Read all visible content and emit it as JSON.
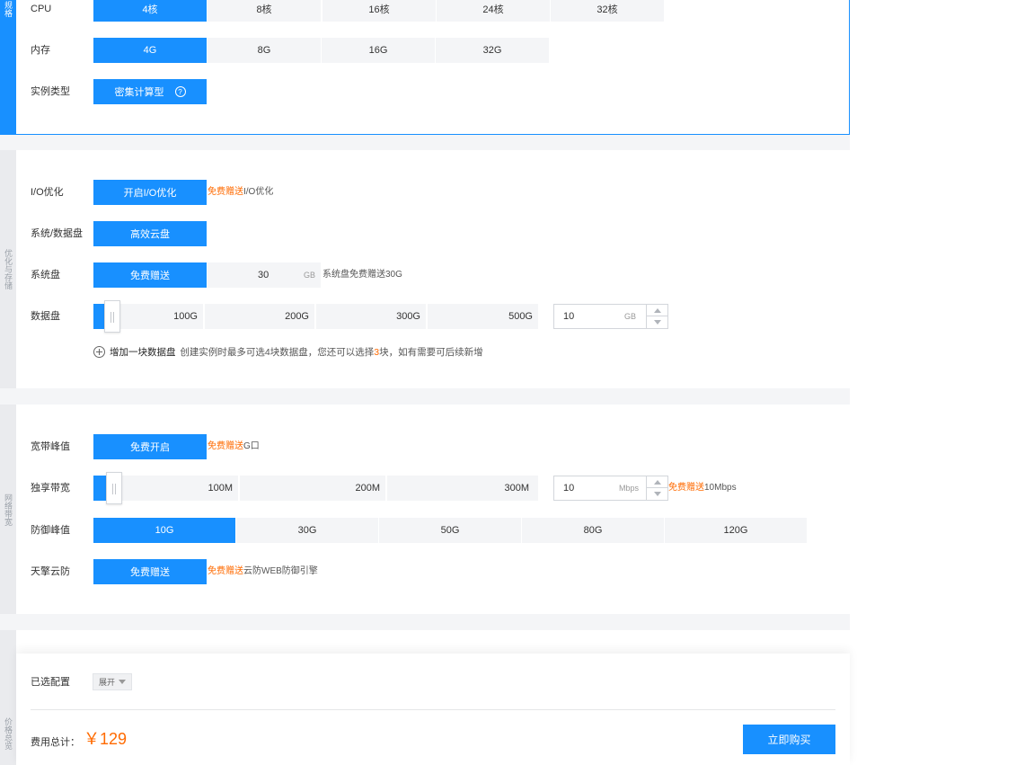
{
  "tabs": {
    "spec": "规格",
    "storage": "优化与存储",
    "network": "网络带宽",
    "summary": "价格总览"
  },
  "spec": {
    "cpu_label": "CPU",
    "cpu_options": [
      "4核",
      "8核",
      "16核",
      "24核",
      "32核"
    ],
    "cpu_selected": "4核",
    "mem_label": "内存",
    "mem_options": [
      "4G",
      "8G",
      "16G",
      "32G"
    ],
    "mem_selected": "4G",
    "type_label": "实例类型",
    "type_option": "密集计算型",
    "help_icon": "?"
  },
  "storage": {
    "io_label": "I/O优化",
    "io_option": "开启I/O优化",
    "io_note_highlight": "免费赠送",
    "io_note_rest": "I/O优化",
    "disk_label": "系统/数据盘",
    "disk_option": "高效云盘",
    "sys_label": "系统盘",
    "sys_option": "免费赠送",
    "sys_value": "30",
    "sys_unit": "GB",
    "sys_note": "系统盘免费赠送30G",
    "data_label": "数据盘",
    "data_ticks": [
      "100G",
      "200G",
      "300G",
      "500G"
    ],
    "data_value": "10",
    "data_unit": "GB",
    "add_disk_link": "增加一块数据盘",
    "add_disk_note_pre": "创建实例时最多可选4块数据盘，您还可以选择",
    "add_disk_note_num": "3",
    "add_disk_note_post": "块，如有需要可后续新增"
  },
  "network": {
    "peak_label": "宽带峰值",
    "peak_option": "免费开启",
    "peak_note_highlight": "免费赠送",
    "peak_note_rest": "G口",
    "excl_label": "独享带宽",
    "excl_ticks": [
      "100M",
      "200M",
      "300M"
    ],
    "excl_value": "10",
    "excl_unit": "Mbps",
    "excl_note_highlight": "免费赠送",
    "excl_note_rest": "10Mbps",
    "ddos_label": "防御峰值",
    "ddos_options": [
      "10G",
      "30G",
      "50G",
      "80G",
      "120G"
    ],
    "ddos_selected": "10G",
    "waf_label": "天擎云防",
    "waf_option": "免费赠送",
    "waf_note_highlight": "免费赠送",
    "waf_note_rest": "云防WEB防御引擎"
  },
  "summary": {
    "selected_label": "已选配置",
    "expand_label": "展开",
    "total_label": "费用总计：",
    "price": "￥129",
    "buy_label": "立即购买"
  },
  "colors": {
    "accent": "#1890ff",
    "highlight": "#ff6a00"
  }
}
